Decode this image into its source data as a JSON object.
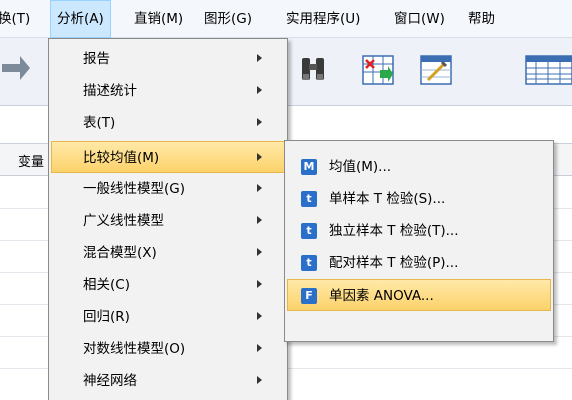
{
  "menubar": {
    "items": [
      {
        "label": "换(T)"
      },
      {
        "label": "分析(A)"
      },
      {
        "label": "直销(M)"
      },
      {
        "label": "图形(G)"
      },
      {
        "label": "实用程序(U)"
      },
      {
        "label": "窗口(W)"
      },
      {
        "label": "帮助"
      }
    ]
  },
  "toolbar": {
    "icons": [
      "redo-icon",
      "find-binoculars-icon",
      "insert-cases-icon",
      "insert-variable-icon",
      "split-file-icon"
    ]
  },
  "grid": {
    "header_label": "变量"
  },
  "analyze_menu": {
    "items": [
      {
        "label": "报告",
        "has_submenu": true
      },
      {
        "label": "描述统计",
        "has_submenu": true
      },
      {
        "label": "表(T)",
        "has_submenu": true
      },
      {
        "label": "比较均值(M)",
        "has_submenu": true,
        "highlighted": true
      },
      {
        "label": "一般线性模型(G)",
        "has_submenu": true
      },
      {
        "label": "广义线性模型",
        "has_submenu": true
      },
      {
        "label": "混合模型(X)",
        "has_submenu": true
      },
      {
        "label": "相关(C)",
        "has_submenu": true
      },
      {
        "label": "回归(R)",
        "has_submenu": true
      },
      {
        "label": "对数线性模型(O)",
        "has_submenu": true
      },
      {
        "label": "神经网络",
        "has_submenu": true
      }
    ]
  },
  "compare_means_submenu": {
    "items": [
      {
        "label": "均值(M)...",
        "icon": "means-icon",
        "icon_letter": "M",
        "icon_color": "#2a6fc9"
      },
      {
        "label": "单样本 T 检验(S)...",
        "icon": "one-sample-t-icon",
        "icon_letter": "t",
        "icon_color": "#2a6fc9"
      },
      {
        "label": "独立样本 T 检验(T)...",
        "icon": "independent-t-icon",
        "icon_letter": "t",
        "icon_color": "#2a6fc9"
      },
      {
        "label": "配对样本 T 检验(P)...",
        "icon": "paired-t-icon",
        "icon_letter": "t",
        "icon_color": "#2a6fc9"
      },
      {
        "label": "单因素 ANOVA...",
        "icon": "one-way-anova-icon",
        "icon_letter": "F",
        "icon_color": "#2a6fc9",
        "highlighted": true
      }
    ]
  },
  "colors": {
    "menu_highlight": "#fcd26a",
    "menubar_active": "#cce8ff"
  }
}
